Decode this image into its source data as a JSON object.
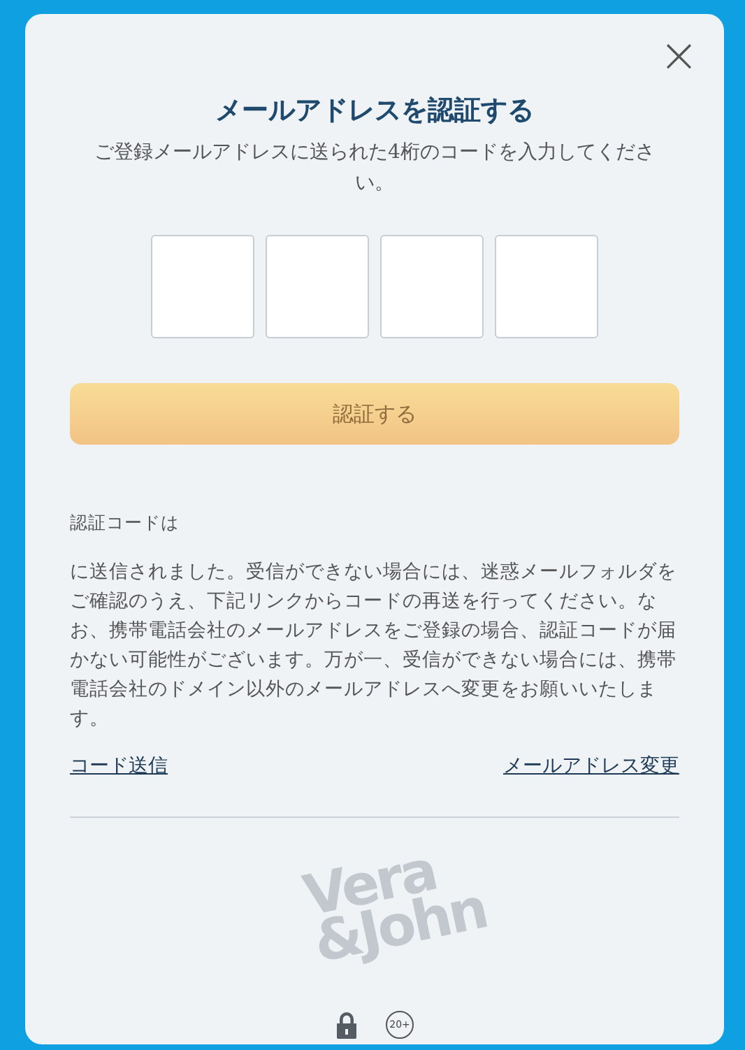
{
  "dialog": {
    "close": "×",
    "title": "メールアドレスを認証する",
    "subtitle": "ご登録メールアドレスに送られた4桁のコードを入力してください。",
    "code_fields": [
      {
        "focused": false
      },
      {
        "focused": false
      },
      {
        "focused": false
      },
      {
        "focused": false
      }
    ],
    "submit": {
      "label": "認証する",
      "disabled": true
    },
    "note_label": "認証コードは",
    "note": "に送信されました。受信ができない場合には、迷惑メールフォルダをご確認のうえ、下記リンクからコードの再送を行ってください。なお、携帯電話会社のメールアドレスをご登録の場合、認証コードが届かない可能性がございます。万が一、受信ができない場合には、携帯電話会社のドメイン以外のメールアドレスへ変更をお願いいたします。",
    "links": [
      "コード送信",
      "メールアドレス変更"
    ],
    "logo": [
      "Vera",
      "&John"
    ],
    "age_badge": "20+"
  }
}
